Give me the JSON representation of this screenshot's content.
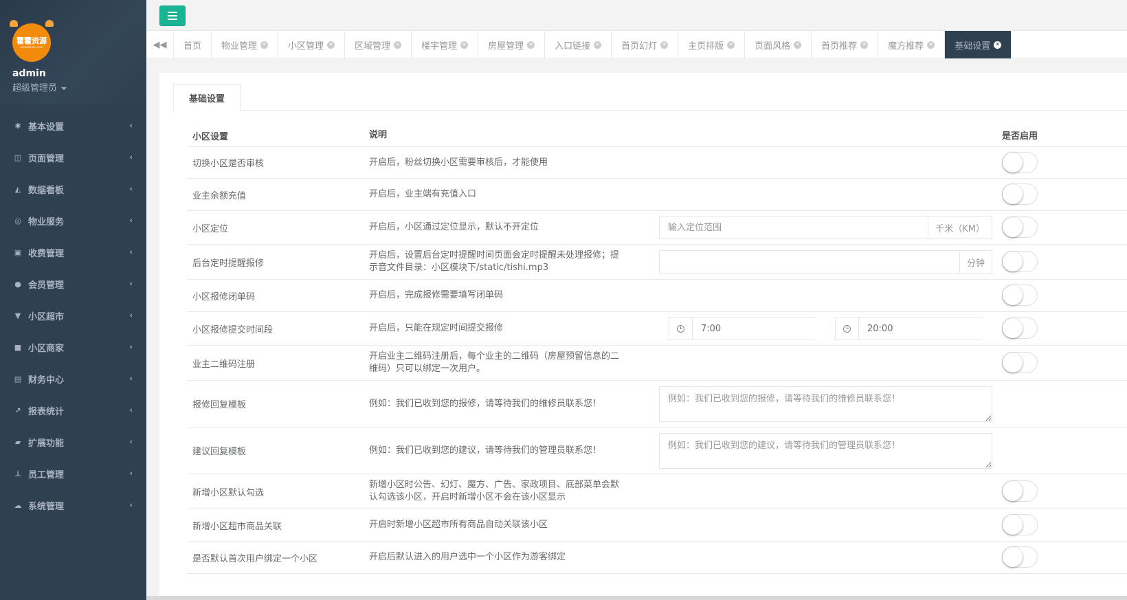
{
  "sidebar": {
    "logo_text": "藿藿资源",
    "logo_sub": "www.lkkuku.com",
    "user_name": "admin",
    "user_role": "超级管理员",
    "items": [
      {
        "label": "基本设置",
        "icon": "gear-icon"
      },
      {
        "label": "页面管理",
        "icon": "columns-icon"
      },
      {
        "label": "数据看板",
        "icon": "area-chart-icon"
      },
      {
        "label": "物业服务",
        "icon": "lifebuoy-icon"
      },
      {
        "label": "收费管理",
        "icon": "money-icon"
      },
      {
        "label": "会员管理",
        "icon": "user-icon"
      },
      {
        "label": "小区超市",
        "icon": "cart-icon"
      },
      {
        "label": "小区商家",
        "icon": "truck-icon"
      },
      {
        "label": "财务中心",
        "icon": "database-icon"
      },
      {
        "label": "报表统计",
        "icon": "line-chart-icon"
      },
      {
        "label": "扩展功能",
        "icon": "folder-open-icon"
      },
      {
        "label": "员工管理",
        "icon": "sitemap-icon"
      },
      {
        "label": "系统管理",
        "icon": "cloud-icon"
      }
    ]
  },
  "tabs": [
    {
      "label": "首页",
      "closable": false,
      "active": false
    },
    {
      "label": "物业管理",
      "closable": true,
      "active": false
    },
    {
      "label": "小区管理",
      "closable": true,
      "active": false
    },
    {
      "label": "区域管理",
      "closable": true,
      "active": false
    },
    {
      "label": "楼宇管理",
      "closable": true,
      "active": false
    },
    {
      "label": "房屋管理",
      "closable": true,
      "active": false
    },
    {
      "label": "入口链接",
      "closable": true,
      "active": false
    },
    {
      "label": "首页幻灯",
      "closable": true,
      "active": false
    },
    {
      "label": "主页排版",
      "closable": true,
      "active": false
    },
    {
      "label": "页面风格",
      "closable": true,
      "active": false
    },
    {
      "label": "首页推荐",
      "closable": true,
      "active": false
    },
    {
      "label": "魔方推荐",
      "closable": true,
      "active": false
    },
    {
      "label": "基础设置",
      "closable": true,
      "active": true
    }
  ],
  "inner_tab": "基础设置",
  "table": {
    "headers": {
      "name": "小区设置",
      "desc": "说明",
      "enabled": "是否启用"
    },
    "rows": [
      {
        "name": "切换小区是否审核",
        "desc": "开启后，粉丝切换小区需要审核后，才能使用",
        "toggle": true
      },
      {
        "name": "业主余额充值",
        "desc": "开启后，业主端有充值入口",
        "toggle": true
      },
      {
        "name": "小区定位",
        "desc": "开启后，小区通过定位显示，默认不开定位",
        "toggle": true,
        "input": {
          "placeholder": "输入定位范围",
          "value": "",
          "addon": "千米（KM）"
        }
      },
      {
        "name": "后台定时提醒报修",
        "desc": "开启后，设置后台定时提醒时间页面会定时提醒未处理报修；提示音文件目录：小区模块下/static/tishi.mp3",
        "toggle": true,
        "input": {
          "placeholder": "",
          "value": "",
          "addon": "分钟"
        }
      },
      {
        "name": "小区报修闭单码",
        "desc": "开启后，完成报修需要填写闭单码",
        "toggle": true
      },
      {
        "name": "小区报修提交时间段",
        "desc": "开启后，只能在规定时间提交报修",
        "toggle": true,
        "start_time": "7:00",
        "end_time": "20:00"
      },
      {
        "name": "业主二维码注册",
        "desc": "开启业主二维码注册后，每个业主的二维码（房屋预留信息的二维码）只可以绑定一次用户。",
        "toggle": true
      },
      {
        "name": "报修回复模板",
        "desc": "例如：我们已收到您的报修，请等待我们的维修员联系您！",
        "toggle": false,
        "textarea_placeholder": "例如：我们已收到您的报修，请等待我们的维修员联系您！"
      },
      {
        "name": "建议回复模板",
        "desc": "例如：我们已收到您的建议，请等待我们的管理员联系您！",
        "toggle": false,
        "textarea_placeholder": "例如：我们已收到您的建议，请等待我们的管理员联系您！"
      },
      {
        "name": "新增小区默认勾选",
        "desc": "新增小区时公告、幻灯、魔方、广告、家政项目、底部菜单会默认勾选该小区，开启时新增小区不会在该小区显示",
        "toggle": true
      },
      {
        "name": "新增小区超市商品关联",
        "desc": "开启时新增小区超市所有商品自动关联该小区",
        "toggle": true
      },
      {
        "name": "是否默认首次用户绑定一个小区",
        "desc": "开启后默认进入的用户选中一个小区作为游客绑定",
        "toggle": true
      }
    ]
  },
  "colors": {
    "sidebar": "#2f4050",
    "accent": "#1ab394",
    "active_tab": "#2f4050"
  }
}
